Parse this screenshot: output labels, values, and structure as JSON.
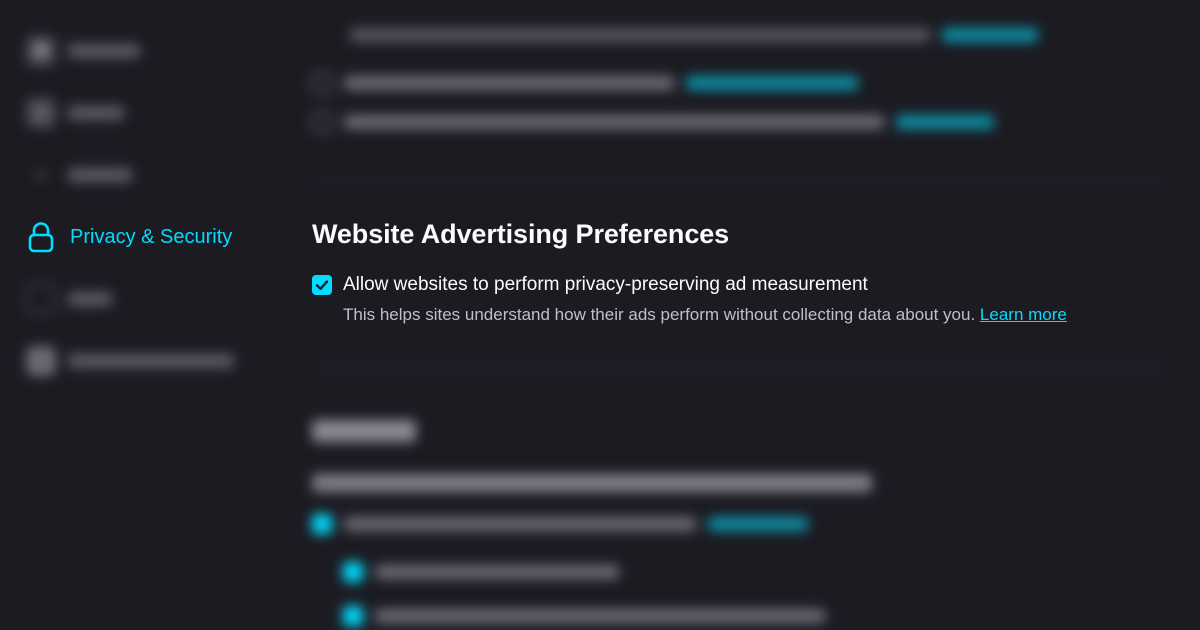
{
  "sidebar": {
    "active_item": {
      "label": "Privacy & Security",
      "icon": "lock-icon"
    }
  },
  "ad_preferences": {
    "heading": "Website Advertising Preferences",
    "option_label": "Allow websites to perform privacy-preserving ad measurement",
    "option_checked": true,
    "helper_text": "This helps sites understand how their ads perform without collecting data about you.",
    "learn_more_label": "Learn more"
  },
  "colors": {
    "background": "#1c1b22",
    "accent": "#00ddff",
    "text_primary": "#fbfbfe",
    "text_secondary": "#bfbfc9"
  }
}
